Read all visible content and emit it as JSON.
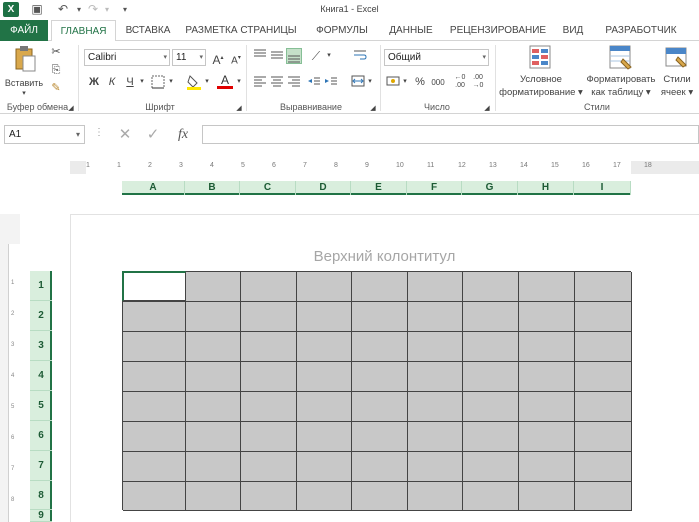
{
  "window": {
    "title": "Книга1 - Excel",
    "logo": "X"
  },
  "quick_access": [
    {
      "icon": "save-icon",
      "glyph": "▣"
    },
    {
      "icon": "undo-icon",
      "glyph": "↶"
    },
    {
      "icon": "redo-icon",
      "glyph": "↷"
    },
    {
      "icon": "customize-icon",
      "glyph": "▾"
    }
  ],
  "tabs": [
    "ФАЙЛ",
    "ГЛАВНАЯ",
    "ВСТАВКА",
    "РАЗМЕТКА СТРАНИЦЫ",
    "ФОРМУЛЫ",
    "ДАННЫЕ",
    "РЕЦЕНЗИРОВАНИЕ",
    "ВИД",
    "РАЗРАБОТЧИК"
  ],
  "ribbon": {
    "clipboard": {
      "paste": "Вставить",
      "label": "Буфер обмена"
    },
    "font": {
      "name": "Calibri",
      "size": "11",
      "bold": "Ж",
      "italic": "К",
      "underline": "Ч",
      "grow": "A",
      "shrink": "A",
      "label": "Шрифт"
    },
    "alignment": {
      "label": "Выравнивание"
    },
    "number": {
      "format": "Общий",
      "percent": "%",
      "thousands": "000",
      "label": "Число"
    },
    "styles": {
      "conditional_line1": "Условное",
      "conditional_line2": "форматирование",
      "table_line1": "Форматировать",
      "table_line2": "как таблицу",
      "cell_line1": "Стили",
      "cell_line2": "ячеек",
      "label": "Стили"
    }
  },
  "formula_bar": {
    "name_box": "A1",
    "cancel": "✕",
    "enter": "✓",
    "fx": "fx",
    "value": ""
  },
  "ruler": {
    "h_numbers": [
      "1",
      "1",
      "2",
      "3",
      "4",
      "5",
      "6",
      "7",
      "8",
      "9",
      "10",
      "11",
      "12",
      "13",
      "14",
      "15",
      "16",
      "17",
      "18"
    ],
    "v_numbers": [
      "1",
      "2",
      "3",
      "4",
      "5",
      "6",
      "7",
      "8"
    ]
  },
  "sheet": {
    "columns": [
      "A",
      "B",
      "C",
      "D",
      "E",
      "F",
      "G",
      "H",
      "I"
    ],
    "rows": [
      "1",
      "2",
      "3",
      "4",
      "5",
      "6",
      "7",
      "8",
      "9"
    ],
    "header_placeholder": "Верхний колонтитул",
    "active_cell": "A1"
  },
  "colors": {
    "accent": "#217346",
    "header_bg": "#d9eedd",
    "cell_fill": "#c8c8c8"
  }
}
